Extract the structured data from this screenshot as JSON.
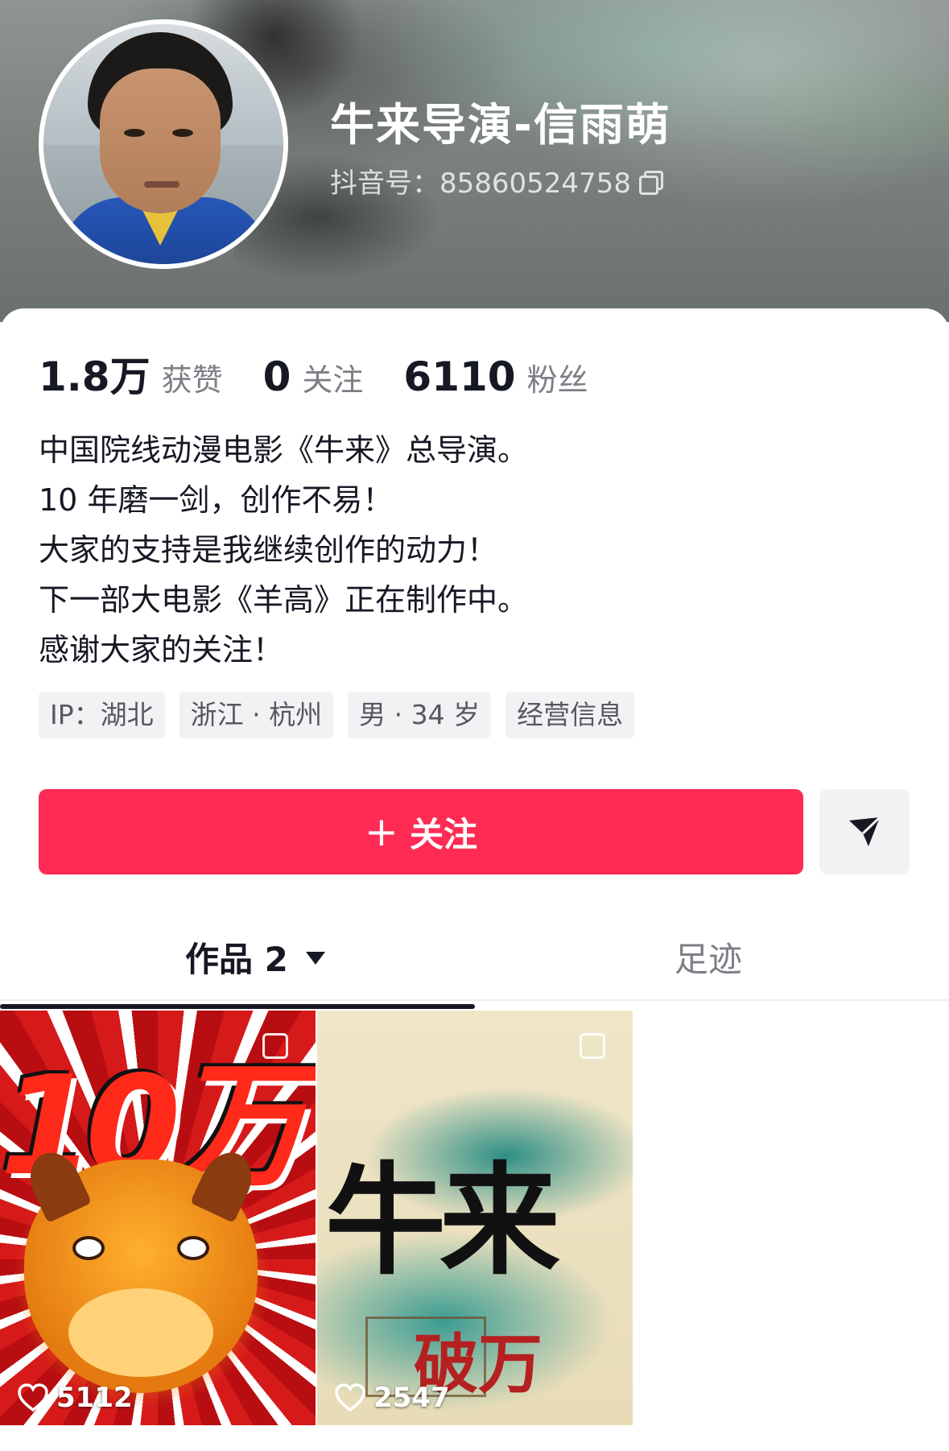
{
  "profile": {
    "nickname": "牛来导演-信雨萌",
    "douyin_id": "抖音号：85860524758"
  },
  "stats": [
    {
      "value": "1.8万",
      "label": "获赞"
    },
    {
      "value": "0",
      "label": "关注"
    },
    {
      "value": "6110",
      "label": "粉丝"
    }
  ],
  "bio": [
    "中国院线动漫电影《牛来》总导演。",
    "10 年磨一剑，创作不易！",
    "大家的支持是我继续创作的动力！",
    "下一部大电影《羊高》正在制作中。",
    "感谢大家的关注！"
  ],
  "tags": [
    "IP：湖北",
    "浙江 · 杭州",
    "男 · 34 岁",
    "经营信息"
  ],
  "actions": {
    "follow_label": "关注",
    "plus": "+"
  },
  "tabs": {
    "works_label": "作品 2",
    "footprint_label": "足迹"
  },
  "videos": [
    {
      "likes": "5112",
      "overlay_text": "10万"
    },
    {
      "likes": "2547",
      "overlay_text": "牛来",
      "overlay_text_2": "破万"
    }
  ],
  "colors": {
    "accent": "#fe2c55",
    "text_primary": "#161823",
    "text_secondary": "#7d7f86",
    "tag_bg": "#f2f2f4"
  },
  "icons": [
    "copy-icon",
    "plus-icon",
    "share-icon",
    "caret-down-icon",
    "heart-icon",
    "multi-image-icon"
  ]
}
